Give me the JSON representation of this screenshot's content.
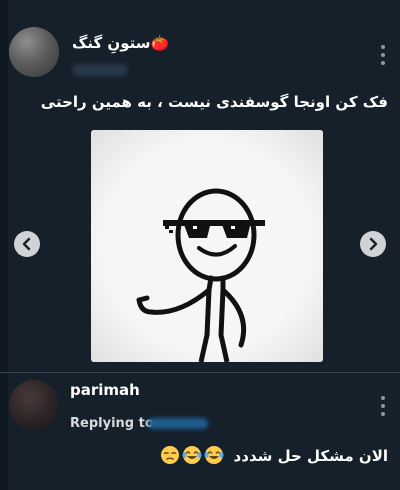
{
  "top_tweet": {
    "display_name": "ستونِ گنگ🍅",
    "text": "فک کن اونجا گوسفندی نیست ، به همین راحتی",
    "icons": [
      "more-vertical-icon"
    ]
  },
  "media": {
    "prev_icon": "chevron-left-icon",
    "next_icon": "chevron-right-icon",
    "image_desc_icon": "meme-stick-figure-sunglasses"
  },
  "reply_tweet": {
    "display_name": "parimah",
    "replying_label": "Replying to",
    "text": "الان مشکل حل شددد",
    "emojis": [
      "😂",
      "😂",
      "😒"
    ]
  },
  "colors": {
    "background": "#15202b",
    "text": "#ffffff",
    "muted": "#8b98a5",
    "divider": "#38444d",
    "accent_blur": "#1d5d8d"
  }
}
